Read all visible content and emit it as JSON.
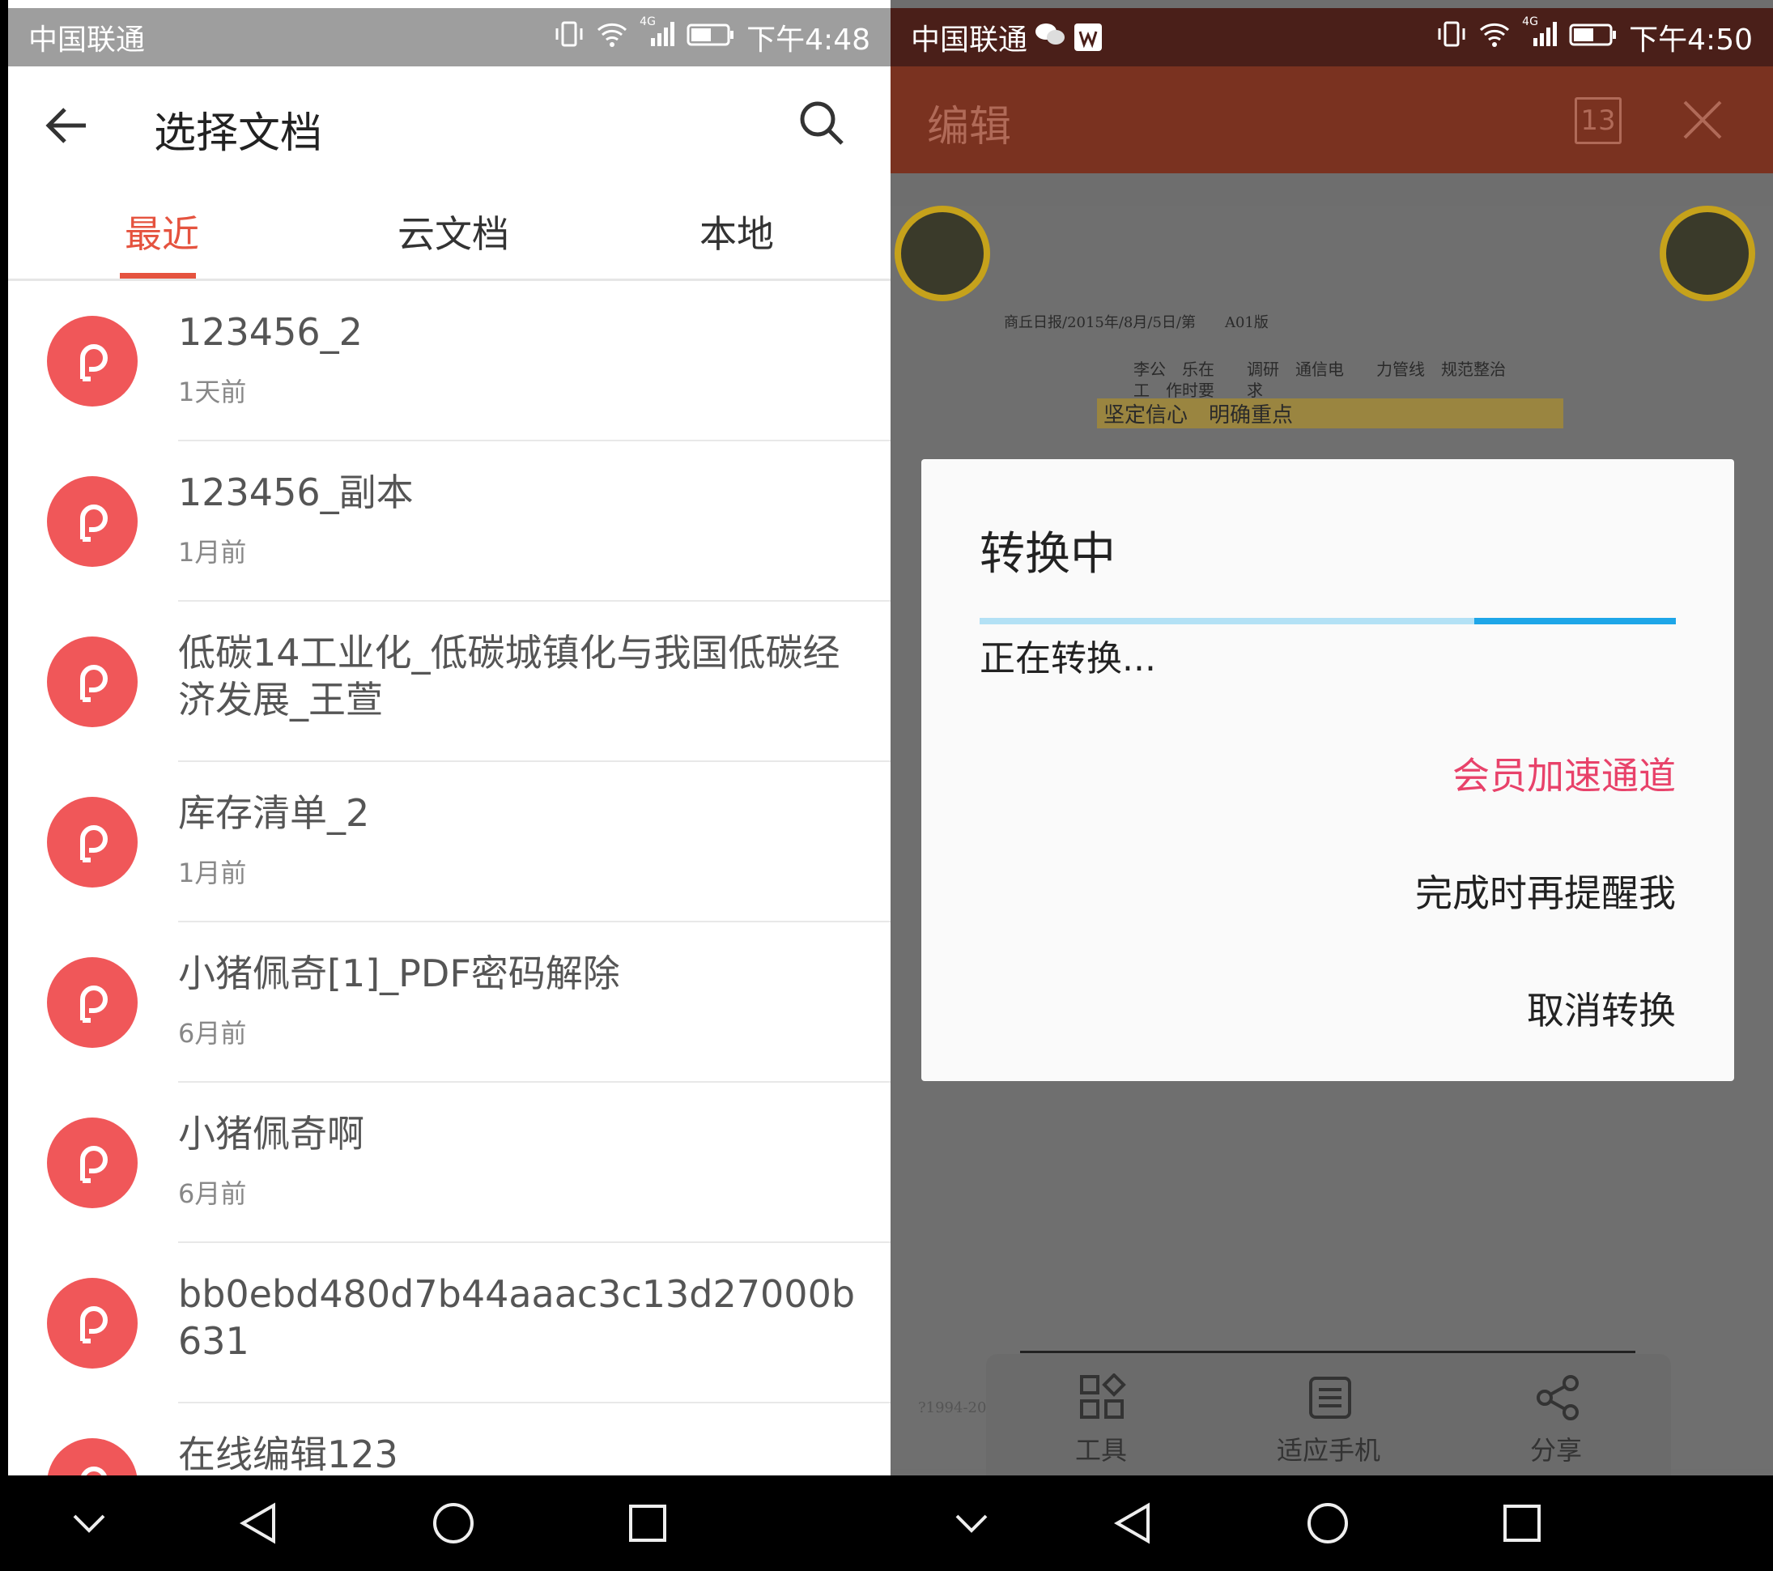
{
  "left": {
    "statusbar": {
      "carrier": "中国联通",
      "network": "4G",
      "time": "下午4:48"
    },
    "header": {
      "title": "选择文档"
    },
    "tabs": [
      {
        "label": "最近"
      },
      {
        "label": "云文档"
      },
      {
        "label": "本地"
      }
    ],
    "files": [
      {
        "name": "123456_2",
        "time": "1天前"
      },
      {
        "name": "123456_副本",
        "time": "1月前"
      },
      {
        "name": "低碳14工业化_低碳城镇化与我国低碳经济发展_王萱",
        "time": ""
      },
      {
        "name": "库存清单_2",
        "time": "1月前"
      },
      {
        "name": "小猪佩奇[1]_PDF密码解除",
        "time": "6月前"
      },
      {
        "name": "小猪佩奇啊",
        "time": "6月前"
      },
      {
        "name": "bb0ebd480d7b44aaac3c13d27000b631",
        "time": ""
      },
      {
        "name": "在线编辑123",
        "time": ""
      }
    ]
  },
  "right": {
    "statusbar": {
      "carrier": "中国联通",
      "network": "4G",
      "time": "下午4:50"
    },
    "header": {
      "title": "编辑",
      "page_count": "13"
    },
    "doc": {
      "meta": "商丘日报/2015年/8月/5日/第　　A01版",
      "line1": "李公　乐在　　调研　通信电　　力管线　规范整治",
      "line2": "工　作时要　　求",
      "line3": "坚定信心　明确重点",
      "footer": "?1994-20"
    },
    "dialog": {
      "title": "转换中",
      "progress": 0.71,
      "message": "正在转换...",
      "vip_button": "会员加速通道",
      "remind_button": "完成时再提醒我",
      "cancel_button": "取消转换"
    },
    "toolbar": [
      {
        "label": "工具"
      },
      {
        "label": "适应手机"
      },
      {
        "label": "分享"
      }
    ]
  },
  "colors": {
    "accent": "#e5533f",
    "file_icon": "#f05759",
    "vip": "#e8426a",
    "progress": "#1ea6e8"
  }
}
